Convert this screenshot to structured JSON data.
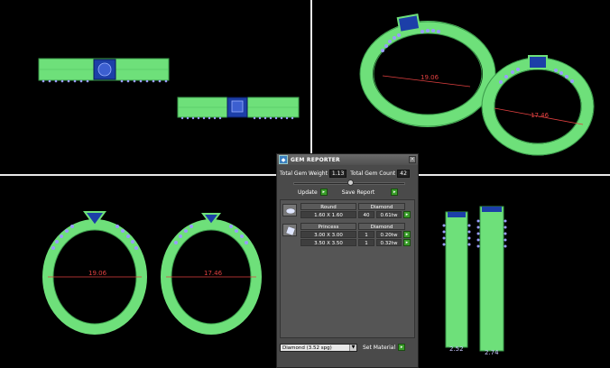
{
  "viewports": {
    "top_right": {
      "dim_left": "19.06",
      "dim_right": "17.46"
    },
    "bottom_left": {
      "dim_left": "19.06",
      "dim_right": "17.46"
    },
    "bottom_right": {
      "dim_left": "2.52",
      "dim_right": "2.74"
    }
  },
  "gem_reporter": {
    "title": "GEM REPORTER",
    "icon": "gem-reporter-icon",
    "total_weight_label": "Total Gem Weight",
    "total_weight_value": "1.13",
    "total_count_label": "Total Gem Count",
    "total_count_value": "42",
    "update_label": "Update",
    "save_report_label": "Save Report",
    "groups": [
      {
        "shape": "Round",
        "material": "Diamond",
        "rows": [
          {
            "size": "1.60 X 1.60",
            "count": "40",
            "weight": "0.61tw"
          }
        ]
      },
      {
        "shape": "Princess",
        "material": "Diamond",
        "rows": [
          {
            "size": "3.00 X 3.00",
            "count": "1",
            "weight": "0.20tw"
          },
          {
            "size": "3.50 X 3.50",
            "count": "1",
            "weight": "0.32tw"
          }
        ]
      }
    ],
    "material_select": "Diamond     (3.52 spg)",
    "set_material_label": "Set Material"
  },
  "colors": {
    "ring_green": "#6ee07a",
    "gem_blue": "#1c3fa8",
    "accent_gems": "#9a9cff",
    "dim_red": "#e04040"
  }
}
